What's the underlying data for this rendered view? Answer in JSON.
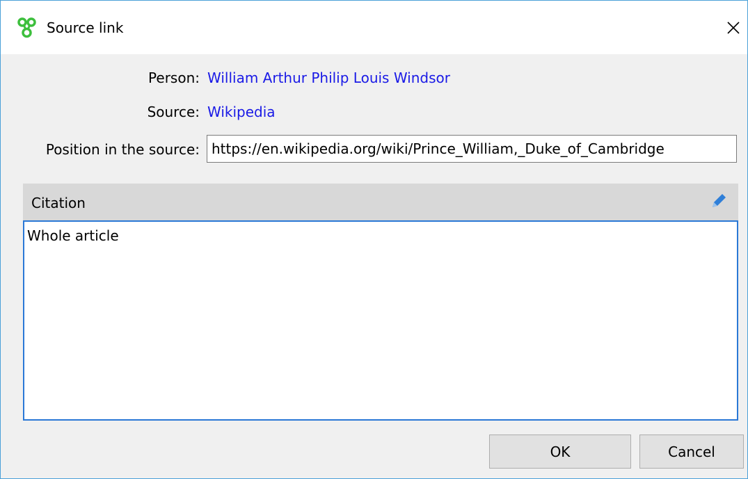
{
  "window": {
    "title": "Source link",
    "app_icon": "app-logo-icon",
    "close_icon": "close-icon"
  },
  "fields": {
    "person_label": "Person:",
    "person_value": "William Arthur Philip Louis Windsor",
    "source_label": "Source:",
    "source_value": "Wikipedia",
    "position_label": "Position in the source:",
    "position_value": "https://en.wikipedia.org/wiki/Prince_William,_Duke_of_Cambridge"
  },
  "citation": {
    "title": "Citation",
    "edit_icon": "pencil-icon",
    "text": "Whole article"
  },
  "buttons": {
    "ok": "OK",
    "cancel": "Cancel"
  },
  "colors": {
    "link": "#1a1ae6",
    "focus_border": "#2a78d6",
    "window_border": "#4aa0d8",
    "icon_green": "#3dbf3d",
    "pencil_blue": "#2f7fd8"
  }
}
